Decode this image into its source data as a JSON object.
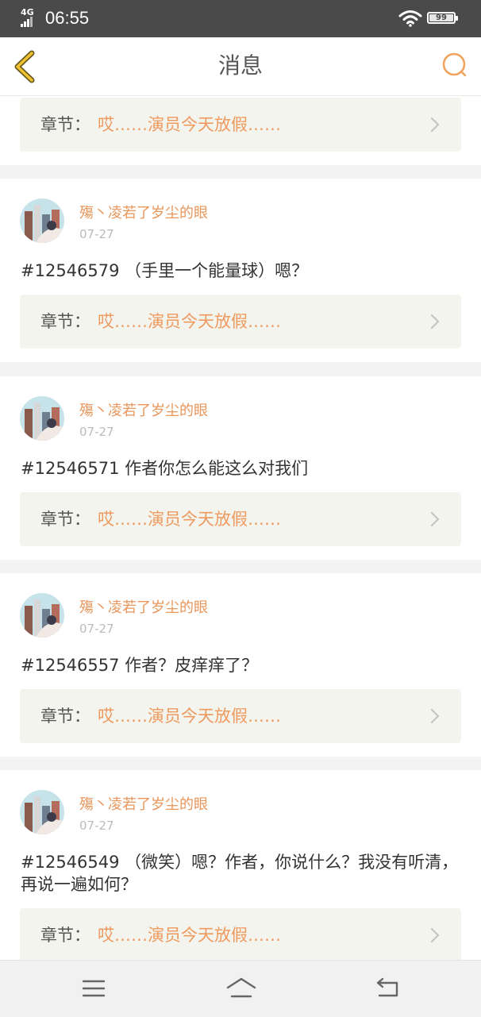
{
  "status_bar": {
    "network": "4G",
    "time": "06:55",
    "battery": "99",
    "icons": [
      "signal-icon",
      "wifi-icon",
      "battery-icon"
    ]
  },
  "nav": {
    "title": "消息",
    "back_icon": "back-chevron-icon",
    "search_icon": "search-icon",
    "accent_color": "#f0a35e"
  },
  "cards": [
    {
      "chapter": {
        "prefix": "章节：",
        "title": "哎……演员今天放假……"
      }
    },
    {
      "user": "殤丶凌若了岁尘的眼",
      "date": "07-27",
      "comment": "#12546579 （手里一个能量球）嗯？",
      "chapter": {
        "prefix": "章节：",
        "title": "哎……演员今天放假……"
      }
    },
    {
      "user": "殤丶凌若了岁尘的眼",
      "date": "07-27",
      "comment": "#12546571 作者你怎么能这么对我们",
      "chapter": {
        "prefix": "章节：",
        "title": "哎……演员今天放假……"
      }
    },
    {
      "user": "殤丶凌若了岁尘的眼",
      "date": "07-27",
      "comment": "#12546557 作者？皮痒痒了？",
      "chapter": {
        "prefix": "章节：",
        "title": "哎……演员今天放假……"
      }
    },
    {
      "user": "殤丶凌若了岁尘的眼",
      "date": "07-27",
      "comment": "#12546549 （微笑）嗯？作者，你说什么？我没有听清，再说一遍如何？",
      "chapter": {
        "prefix": "章节：",
        "title": "哎……演员今天放假……"
      }
    }
  ],
  "bottom_bar": {
    "icons": [
      "menu-icon",
      "home-icon",
      "return-icon"
    ]
  },
  "colors": {
    "username": "#e8965a",
    "chapter_title": "#ee9a5e",
    "chapter_bg": "#f4f4ef",
    "status_bg": "#4a4a4a"
  }
}
